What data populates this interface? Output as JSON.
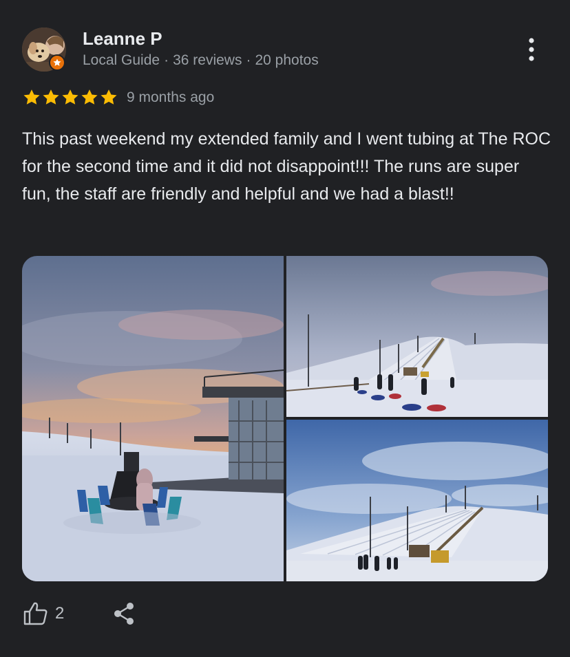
{
  "reviewer": {
    "name": "Leanne P",
    "meta": {
      "badge": "Local Guide",
      "reviews": "36 reviews",
      "photos": "20 photos",
      "separator": "·"
    }
  },
  "rating": {
    "stars": 5,
    "max": 5
  },
  "review": {
    "date": "9 months ago",
    "text": "This past weekend my extended family and I went tubing at The ROC for the second time and it did not disappoint!!! The runs are super fun, the staff are friendly and helpful and we had a blast!!"
  },
  "actions": {
    "like_count": "2"
  },
  "icons": {
    "more": "more-vert-icon",
    "badge": "local-guide-star-icon",
    "like": "thumb-up-icon",
    "share": "share-icon",
    "star": "star-icon"
  },
  "colors": {
    "background": "#202124",
    "star": "#fbbc04",
    "badge": "#e8710a",
    "primary_text": "#e8eaed",
    "secondary_text": "#9aa0a6"
  }
}
